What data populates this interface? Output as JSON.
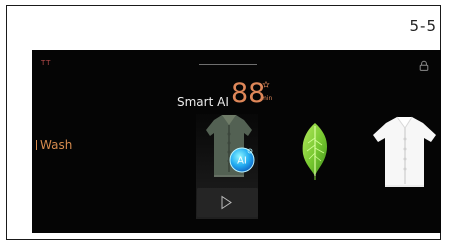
{
  "page": {
    "page_number": "5-5"
  },
  "screen": {
    "indicator": "TT",
    "program_label": "Wash",
    "smart_label": "Smart AI",
    "time_value": "88",
    "time_unit": "min",
    "badge_label": "AI",
    "icons": {
      "lock": "lock-icon",
      "play": "play-icon",
      "shirt_left": "shirt-icon",
      "leaf": "leaf-icon",
      "shirt_right": "shirt-icon"
    },
    "colors": {
      "background": "#050505",
      "accent": "#df8759",
      "label": "#d58a4d"
    }
  }
}
